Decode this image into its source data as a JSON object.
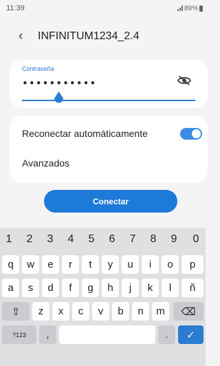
{
  "status": {
    "time": "11:39",
    "battery": "89%"
  },
  "header": {
    "back_icon": "back-chevron-icon",
    "title": "INFINITUM1234_2.4"
  },
  "password": {
    "label": "Contraseña",
    "value": "•••••••••••",
    "visibility_icon": "eye-off-icon"
  },
  "options": {
    "reconnect_label": "Reconectar automáticamente",
    "reconnect_on": true,
    "advanced_label": "Avanzados"
  },
  "connect_button": {
    "label": "Conectar"
  },
  "keyboard": {
    "numbers": [
      "1",
      "2",
      "3",
      "4",
      "5",
      "6",
      "7",
      "8",
      "9",
      "0"
    ],
    "row1": [
      "q",
      "w",
      "e",
      "r",
      "t",
      "y",
      "u",
      "i",
      "o",
      "p"
    ],
    "row2": [
      "a",
      "s",
      "d",
      "f",
      "g",
      "h",
      "j",
      "k",
      "l",
      "ñ"
    ],
    "row3": [
      "z",
      "x",
      "c",
      "v",
      "b",
      "n",
      "m"
    ],
    "shift": "⇧",
    "backspace": "⌫",
    "symbols": "?123",
    "comma": ",",
    "period": ".",
    "enter": "✓"
  },
  "colors": {
    "accent": "#1e7ad8"
  }
}
